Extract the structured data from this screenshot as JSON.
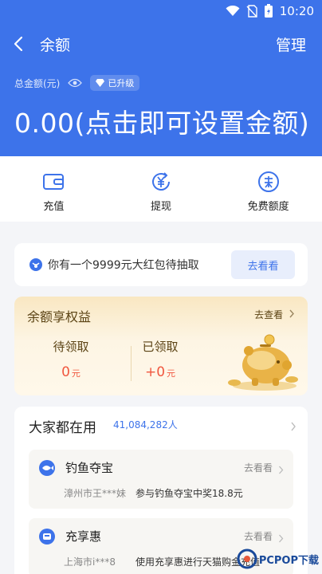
{
  "status_bar": {
    "time": "10:20"
  },
  "nav": {
    "title": "余额",
    "manage": "管理"
  },
  "balance": {
    "total_label": "总金额(元)",
    "badge": "已升级",
    "amount": "0.00(点击即可设置金额)"
  },
  "actions": [
    {
      "label": "充值",
      "icon": "wallet-icon"
    },
    {
      "label": "提现",
      "icon": "yuan-withdraw-icon"
    },
    {
      "label": "免费额度",
      "icon": "free-quota-icon"
    }
  ],
  "red_packet": {
    "text": "你有一个9999元大红包待抽取",
    "button": "去看看"
  },
  "benefit": {
    "title": "余额享权益",
    "link": "去查看",
    "pending_label": "待领取",
    "pending_value": "0",
    "received_label": "已领取",
    "received_value": "+0",
    "unit": "元"
  },
  "using": {
    "title": "大家都在用",
    "count": "41,084,282人",
    "items": [
      {
        "icon": "fish-icon",
        "title": "钓鱼夺宝",
        "go": "去看看",
        "city": "漳州市王***妹",
        "desc": "参与钓鱼夺宝中奖18.8元"
      },
      {
        "icon": "recharge-icon",
        "title": "充享惠",
        "go": "去看看",
        "city": "上海市i***8",
        "desc": "使用充享惠进行天猫购金充值"
      }
    ]
  },
  "watermark": "PCPOP下载",
  "colors": {
    "primary": "#3d73ea",
    "accent_red": "#f0573f",
    "gold_text": "#5b4314"
  }
}
